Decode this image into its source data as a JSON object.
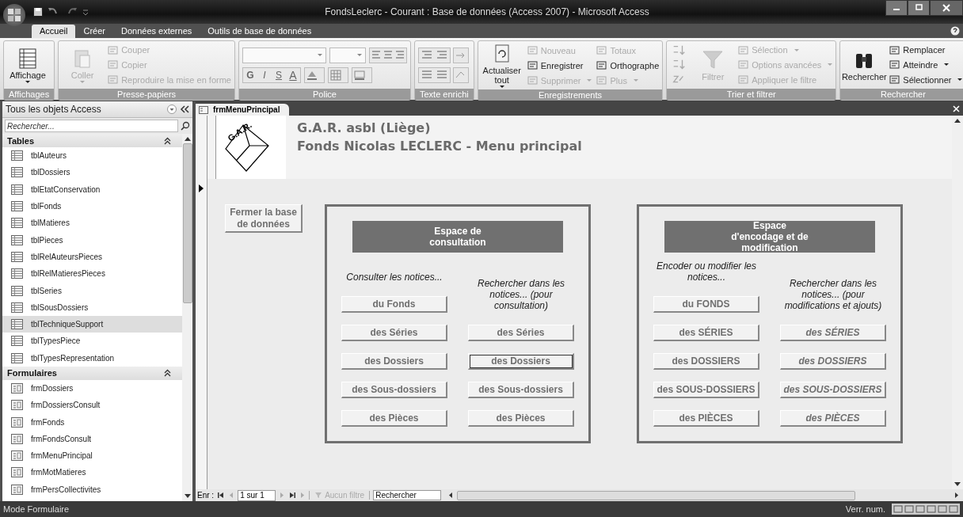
{
  "window": {
    "title": "FondsLeclerc - Courant : Base de données (Access 2007) - Microsoft Access"
  },
  "ribbon_tabs": [
    {
      "label": "Accueil",
      "selected": true
    },
    {
      "label": "Créer",
      "selected": false
    },
    {
      "label": "Données externes",
      "selected": false
    },
    {
      "label": "Outils de base de données",
      "selected": false
    }
  ],
  "ribbon_groups": [
    {
      "label": "Affichages",
      "columns": [
        [
          {
            "kind": "large",
            "label": "Affichage",
            "disabled": false,
            "has_menu": true
          }
        ]
      ]
    },
    {
      "label": "Presse-papiers",
      "columns": [
        [
          {
            "kind": "large",
            "label": "Coller",
            "disabled": true,
            "has_menu": true
          }
        ],
        [
          {
            "kind": "small",
            "label": "Couper",
            "disabled": true,
            "has_menu": false
          },
          {
            "kind": "small",
            "label": "Copier",
            "disabled": true,
            "has_menu": false
          },
          {
            "kind": "small",
            "label": "Reproduire la mise en forme",
            "disabled": true,
            "has_menu": false
          }
        ]
      ]
    },
    {
      "label": "Police",
      "columns": [
        [
          {
            "kind": "fontbar",
            "format": [
              "G",
              "I",
              "S",
              "A"
            ]
          }
        ]
      ]
    },
    {
      "label": "Texte enrichi",
      "columns": [
        [
          {
            "kind": "richbar"
          }
        ]
      ]
    },
    {
      "label": "Enregistrements",
      "columns": [
        [
          {
            "kind": "large",
            "label": "Actualiser tout",
            "disabled": false,
            "has_menu": true
          }
        ],
        [
          {
            "kind": "small",
            "label": "Nouveau",
            "disabled": true,
            "has_menu": false
          },
          {
            "kind": "small",
            "label": "Enregistrer",
            "disabled": false,
            "has_menu": false
          },
          {
            "kind": "small",
            "label": "Supprimer",
            "disabled": true,
            "has_menu": true
          }
        ],
        [
          {
            "kind": "small",
            "label": "Totaux",
            "disabled": true,
            "has_menu": false
          },
          {
            "kind": "small",
            "label": "Orthographe",
            "disabled": false,
            "has_menu": false
          },
          {
            "kind": "small",
            "label": "Plus",
            "disabled": true,
            "has_menu": true
          }
        ]
      ]
    },
    {
      "label": "Trier et filtrer",
      "columns": [
        [
          {
            "kind": "sort"
          }
        ],
        [
          {
            "kind": "large",
            "label": "Filtrer",
            "disabled": true,
            "has_menu": false
          }
        ],
        [
          {
            "kind": "small",
            "label": "Sélection",
            "disabled": true,
            "has_menu": true
          },
          {
            "kind": "small",
            "label": "Options avancées",
            "disabled": true,
            "has_menu": true
          },
          {
            "kind": "small",
            "label": "Appliquer le filtre",
            "disabled": true,
            "has_menu": false
          }
        ]
      ]
    },
    {
      "label": "Rechercher",
      "columns": [
        [
          {
            "kind": "large",
            "label": "Rechercher",
            "disabled": false,
            "has_menu": false
          }
        ],
        [
          {
            "kind": "small",
            "label": "Remplacer",
            "disabled": false,
            "has_menu": false
          },
          {
            "kind": "small",
            "label": "Atteindre",
            "disabled": false,
            "has_menu": true
          },
          {
            "kind": "small",
            "label": "Sélectionner",
            "disabled": false,
            "has_menu": true
          }
        ]
      ]
    }
  ],
  "navigation_pane": {
    "title": "Tous les objets Access",
    "search": {
      "placeholder": "Rechercher..."
    },
    "sections": [
      {
        "title": "Tables",
        "kind": "table",
        "expanded": true,
        "items": [
          {
            "label": "tblAuteurs",
            "selected": false
          },
          {
            "label": "tblDossiers",
            "selected": false
          },
          {
            "label": "tblEtatConservation",
            "selected": false
          },
          {
            "label": "tblFonds",
            "selected": false
          },
          {
            "label": "tblMatieres",
            "selected": false
          },
          {
            "label": "tblPieces",
            "selected": false
          },
          {
            "label": "tblRelAuteursPieces",
            "selected": false
          },
          {
            "label": "tblRelMatieresPieces",
            "selected": false
          },
          {
            "label": "tblSeries",
            "selected": false
          },
          {
            "label": "tblSousDossiers",
            "selected": false
          },
          {
            "label": "tblTechniqueSupport",
            "selected": true
          },
          {
            "label": "tblTypesPiece",
            "selected": false
          },
          {
            "label": "tblTypesRepresentation",
            "selected": false
          }
        ]
      },
      {
        "title": "Formulaires",
        "kind": "form",
        "expanded": true,
        "items": [
          {
            "label": "frmDossiers",
            "selected": false
          },
          {
            "label": "frmDossiersConsult",
            "selected": false
          },
          {
            "label": "frmFonds",
            "selected": false
          },
          {
            "label": "frmFondsConsult",
            "selected": false
          },
          {
            "label": "frmMenuPrincipal",
            "selected": false
          },
          {
            "label": "frmMotMatieres",
            "selected": false
          },
          {
            "label": "frmPersCollectivites",
            "selected": false
          }
        ]
      }
    ]
  },
  "document_tab": {
    "label": "frmMenuPrincipal"
  },
  "form": {
    "logo_text": "G.A.R.",
    "title": "G.A.R. asbl (Liège)",
    "subtitle": "Fonds Nicolas LECLERC - Menu principal",
    "close_button": "Fermer la base de données",
    "panels": [
      {
        "heading": "Espace de consultation",
        "columns": [
          {
            "caption": "Consulter les notices...",
            "italic": false,
            "buttons": [
              {
                "label": "du Fonds",
                "focused": false
              },
              {
                "label": "des Séries",
                "focused": false
              },
              {
                "label": "des Dossiers",
                "focused": false
              },
              {
                "label": "des Sous-dossiers",
                "focused": false
              },
              {
                "label": "des Pièces",
                "focused": false
              }
            ]
          },
          {
            "caption": "Rechercher dans les notices... (pour consultation)",
            "italic": false,
            "buttons": [
              {
                "label": "des Séries",
                "focused": false
              },
              {
                "label": "des Dossiers",
                "focused": true
              },
              {
                "label": "des Sous-dossiers",
                "focused": false
              },
              {
                "label": "des Pièces",
                "focused": false
              }
            ]
          }
        ]
      },
      {
        "heading": "Espace d'encodage et de modification",
        "columns": [
          {
            "caption": "Encoder ou modifier les notices...",
            "italic": false,
            "buttons": [
              {
                "label": "du FONDS",
                "focused": false
              },
              {
                "label": "des SÉRIES",
                "focused": false
              },
              {
                "label": "des DOSSIERS",
                "focused": false
              },
              {
                "label": "des SOUS-DOSSIERS",
                "focused": false
              },
              {
                "label": "des PIÈCES",
                "focused": false
              }
            ]
          },
          {
            "caption": "Rechercher dans les notices... (pour modifications et ajouts)",
            "italic": true,
            "buttons": [
              {
                "label": "des SÉRIES",
                "focused": false
              },
              {
                "label": "des DOSSIERS",
                "focused": false
              },
              {
                "label": "des SOUS-DOSSIERS",
                "focused": false
              },
              {
                "label": "des PIÈCES",
                "focused": false
              }
            ]
          }
        ]
      }
    ]
  },
  "record_navigator": {
    "label": "Enr :",
    "position": "1 sur 1",
    "filter": {
      "label": "Aucun filtre",
      "disabled": true
    },
    "search": {
      "placeholder": "Rechercher"
    }
  },
  "status_bar": {
    "mode": "Mode Formulaire",
    "indicator": "Verr. num."
  }
}
